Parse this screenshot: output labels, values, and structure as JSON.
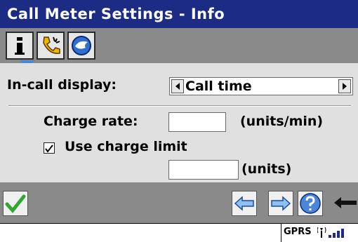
{
  "window": {
    "title": "Call Meter Settings - Info"
  },
  "tabs": [
    {
      "icon": "info-icon",
      "selected": true
    },
    {
      "icon": "phone-call-icon",
      "selected": false
    },
    {
      "icon": "globe-icon",
      "selected": false
    }
  ],
  "form": {
    "in_call_display_label": "In-call display:",
    "in_call_display_value": "Call time",
    "charge_rate_label": "Charge rate:",
    "charge_rate_value": "",
    "charge_rate_unit": "(units/min)",
    "use_charge_limit_label": "Use charge limit",
    "use_charge_limit_checked": true,
    "charge_limit_value": "",
    "charge_limit_unit": "(units)"
  },
  "toolbar": {
    "icons": [
      "checkmark-icon",
      "arrow-left-icon",
      "arrow-right-icon",
      "help-icon",
      "return-icon"
    ]
  },
  "status": {
    "connection": "GPRS"
  },
  "colors": {
    "title_bar": "#1c2c84",
    "toolbar": "#8a8a8a",
    "panel": "#e0e0e0",
    "accent_blue": "#4a86d8",
    "check_green": "#2fa82f"
  }
}
